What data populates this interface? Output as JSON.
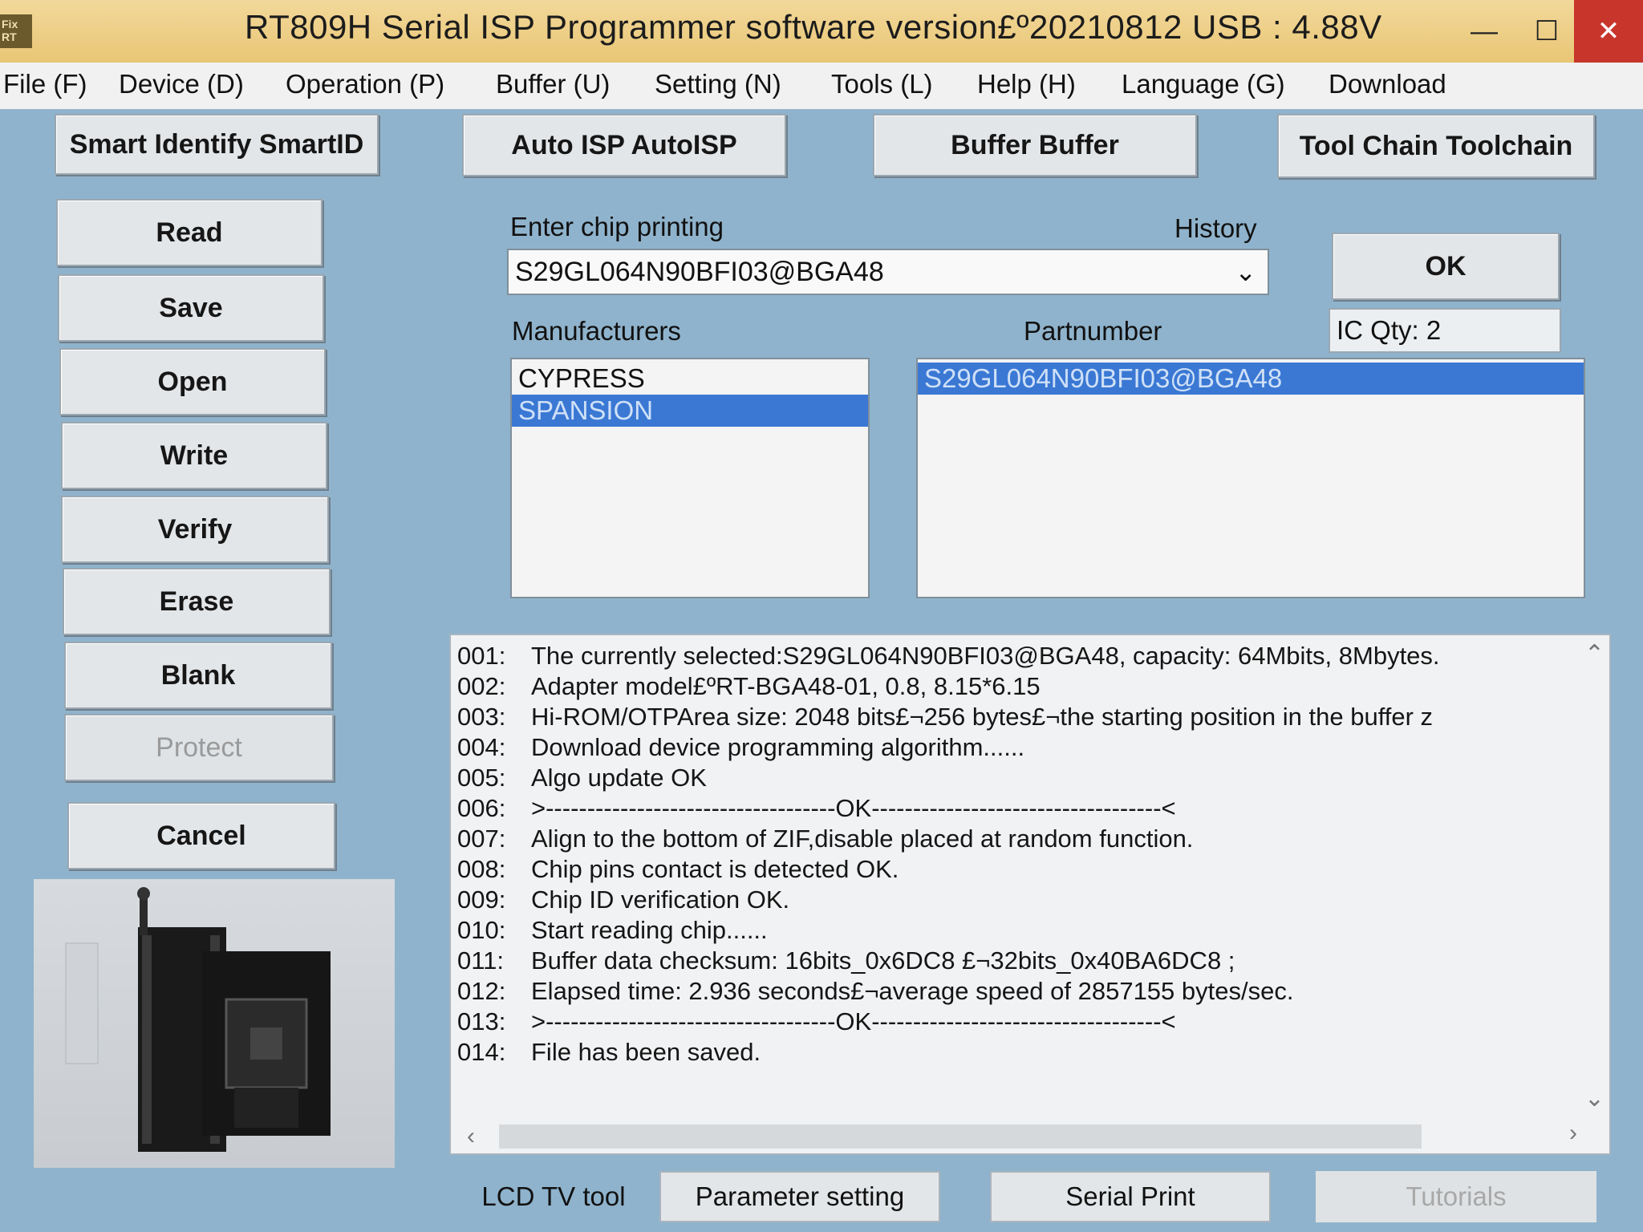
{
  "window": {
    "title": "RT809H Serial ISP Programmer software version£º20210812  USB : 4.88V",
    "min_glyph": "—",
    "max_glyph": "☐",
    "close_glyph": "✕"
  },
  "menu": [
    "File (F)",
    "Device (D)",
    "Operation (P)",
    "Buffer (U)",
    "Setting (N)",
    "Tools (L)",
    "Help (H)",
    "Language (G)",
    "Download"
  ],
  "toolbar": {
    "smart_identify": "Smart Identify SmartID",
    "auto_isp": "Auto ISP AutoISP",
    "buffer": "Buffer Buffer",
    "tool_chain": "Tool Chain Toolchain"
  },
  "side_buttons": {
    "read": "Read",
    "save": "Save",
    "open": "Open",
    "write": "Write",
    "verify": "Verify",
    "erase": "Erase",
    "blank": "Blank",
    "protect": "Protect",
    "cancel": "Cancel"
  },
  "chip": {
    "enter_label": "Enter chip printing",
    "history_label": "History",
    "value": "S29GL064N90BFI03@BGA48",
    "ok_label": "OK",
    "manufacturers_label": "Manufacturers",
    "partnumber_label": "Partnumber",
    "ic_qty": "IC Qty: 2",
    "manufacturers": [
      "CYPRESS",
      "SPANSION"
    ],
    "selected_manufacturer": "SPANSION",
    "partnumbers": [
      "S29GL064N90BFI03@BGA48"
    ]
  },
  "log": [
    {
      "num": "001:",
      "text": "The currently selected:S29GL064N90BFI03@BGA48, capacity: 64Mbits, 8Mbytes."
    },
    {
      "num": "002:",
      "text": "Adapter model£ºRT-BGA48-01, 0.8, 8.15*6.15"
    },
    {
      "num": "003:",
      "text": "Hi-ROM/OTPArea size: 2048 bits£¬256 bytes£¬the starting position in the buffer z"
    },
    {
      "num": "004:",
      "text": "Download device programming algorithm......"
    },
    {
      "num": "005:",
      "text": "Algo update OK"
    },
    {
      "num": "006:",
      "text": ">-----------------------------------OK-----------------------------------<"
    },
    {
      "num": "007:",
      "text": "Align to the bottom of ZIF,disable placed at random function."
    },
    {
      "num": "008:",
      "text": "Chip pins contact is detected OK."
    },
    {
      "num": "009:",
      "text": "Chip ID verification OK."
    },
    {
      "num": "010:",
      "text": "Start reading chip......"
    },
    {
      "num": "011:",
      "text": "Buffer data checksum: 16bits_0x6DC8 £¬32bits_0x40BA6DC8 ;"
    },
    {
      "num": "012:",
      "text": "Elapsed time: 2.936 seconds£¬average speed of 2857155 bytes/sec."
    },
    {
      "num": "013:",
      "text": ">-----------------------------------OK-----------------------------------<"
    },
    {
      "num": "014:",
      "text": "File has been saved."
    }
  ],
  "bottom": {
    "lcd_tv_tool": "LCD TV tool",
    "parameter_setting": "Parameter setting",
    "serial_print": "Serial Print",
    "tutorials": "Tutorials"
  }
}
